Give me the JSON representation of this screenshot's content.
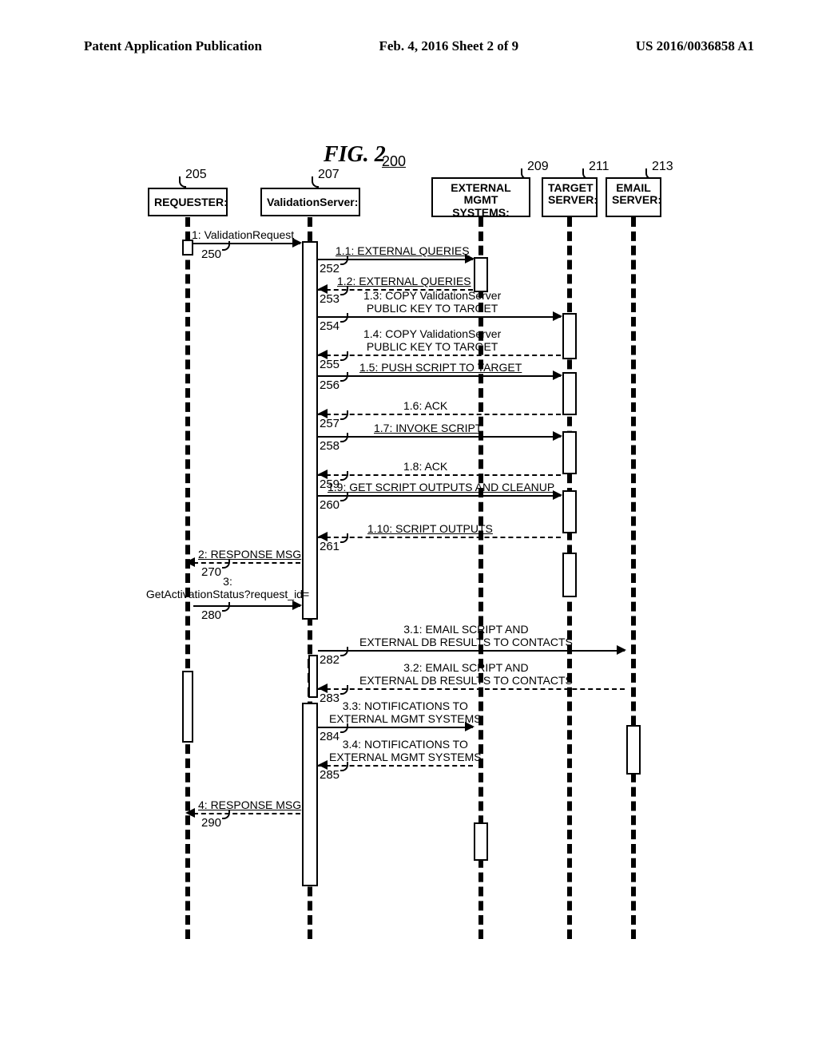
{
  "header": {
    "left": "Patent Application Publication",
    "mid": "Feb. 4, 2016  Sheet 2 of 9",
    "right": "US 2016/0036858 A1"
  },
  "figure": {
    "label": "FIG.  2",
    "number_underlined": "200"
  },
  "participants": {
    "requester": {
      "label": "REQUESTER:",
      "callout": "205"
    },
    "validation": {
      "label": "ValidationServer:",
      "callout": "207"
    },
    "ext_mgmt": {
      "label": "EXTERNAL\nMGMT SYSTEMS:",
      "callout": "209"
    },
    "target": {
      "label": "TARGET\nSERVER:",
      "callout": "211"
    },
    "email": {
      "label": "EMAIL\nSERVER:",
      "callout": "213"
    }
  },
  "messages": {
    "m1": {
      "label": "1: ValidationRequest",
      "ref": "250"
    },
    "m1_1": {
      "label": "1.1: EXTERNAL QUERIES",
      "ref": "252"
    },
    "m1_2": {
      "label": "1.2: EXTERNAL QUERIES",
      "ref": "253"
    },
    "m1_3": {
      "label": "1.3: COPY ValidationServer\nPUBLIC KEY TO TARGET",
      "ref": "254"
    },
    "m1_4": {
      "label": "1.4: COPY ValidationServer\nPUBLIC KEY TO TARGET",
      "ref": "255"
    },
    "m1_5": {
      "label": "1.5: PUSH SCRIPT TO TARGET",
      "ref": "256"
    },
    "m1_6": {
      "label": "1.6: ACK",
      "ref": "257"
    },
    "m1_7": {
      "label": "1.7: INVOKE SCRIPT",
      "ref": "258"
    },
    "m1_8": {
      "label": "1.8: ACK",
      "ref": "259"
    },
    "m1_9": {
      "label": "1.9: GET SCRIPT OUTPUTS AND CLEANUP",
      "ref": "260"
    },
    "m1_10": {
      "label": "1.10: SCRIPT OUTPUTS",
      "ref": "261"
    },
    "m2": {
      "label": "2: RESPONSE MSG",
      "ref": "270"
    },
    "m3": {
      "label": "3:\nGetActivationStatus?request_id=",
      "ref": "280"
    },
    "m3_1": {
      "label": "3.1: EMAIL SCRIPT AND\nEXTERNAL DB RESULTS TO CONTACTS",
      "ref": "282"
    },
    "m3_2": {
      "label": "3.2: EMAIL SCRIPT AND\nEXTERNAL DB RESULTS TO CONTACTS",
      "ref": "283"
    },
    "m3_3": {
      "label": "3.3: NOTIFICATIONS TO\nEXTERNAL MGMT SYSTEMS",
      "ref": "284"
    },
    "m3_4": {
      "label": "3.4: NOTIFICATIONS TO\nEXTERNAL MGMT SYSTEMS",
      "ref": "285"
    },
    "m4": {
      "label": "4: RESPONSE MSG",
      "ref": "290"
    }
  }
}
